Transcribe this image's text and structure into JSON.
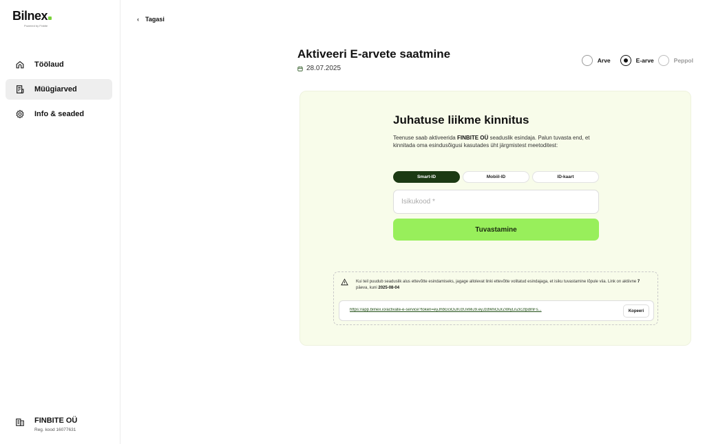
{
  "brand": {
    "name": "Bilnex",
    "tagline": "Powered by Finbite",
    "accent_color": "#7ad33a"
  },
  "sidebar": {
    "items": [
      {
        "label": "Töölaud",
        "icon": "home-icon",
        "active": false
      },
      {
        "label": "Müügiarved",
        "icon": "invoice-icon",
        "active": true
      },
      {
        "label": "Info & seaded",
        "icon": "gear-icon",
        "active": false
      }
    ],
    "company": {
      "name": "FINBITE OÜ",
      "reg": "Reg. kood 16077631",
      "icon": "building-icon"
    }
  },
  "header": {
    "back_label": "Tagasi",
    "title": "Aktiveeri E-arvete saatmine",
    "date": "28.07.2025"
  },
  "invoice_type": {
    "options": [
      {
        "label": "Arve",
        "checked": false,
        "disabled": false
      },
      {
        "label": "E-arve",
        "checked": true,
        "disabled": false
      },
      {
        "label": "Peppol",
        "checked": false,
        "disabled": true
      }
    ]
  },
  "card": {
    "title": "Juhatuse liikme kinnitus",
    "desc_prefix": "Teenuse saab aktiveerida ",
    "desc_company": "FINBITE OÜ",
    "desc_suffix": " seaduslik esindaja. Palun tuvasta end, et kinnitada oma esindusõigusi kasutades üht järgmistest meetoditest:",
    "tabs": [
      {
        "label": "Smart-ID",
        "active": true
      },
      {
        "label": "Mobiil-ID",
        "active": false
      },
      {
        "label": "ID-kaart",
        "active": false
      }
    ],
    "input_placeholder": "Isikukood *",
    "submit_label": "Tuvastamine",
    "accent_color": "#98ef5b",
    "tab_active_color": "#1c3a13"
  },
  "notice": {
    "text_prefix": "Kui teil puudub seaduslik alus ettevõtte esindamiseks, jagage allolevat linki ettevõtte volitatud esindajaga, et isiku tuvastamine lõpule viia. Link on aktiivne ",
    "days": "7",
    "text_mid": " päeva, kuni ",
    "expiry": "2025-08-04",
    "link": "https://app.bilnex.io/activate-e-service?token=eyJhbGciOiJIUzUxMiJ9.eyJzdWIiOiJrZWlyLnZlc2tpdmFs...",
    "copy_label": "Kopeeri"
  }
}
